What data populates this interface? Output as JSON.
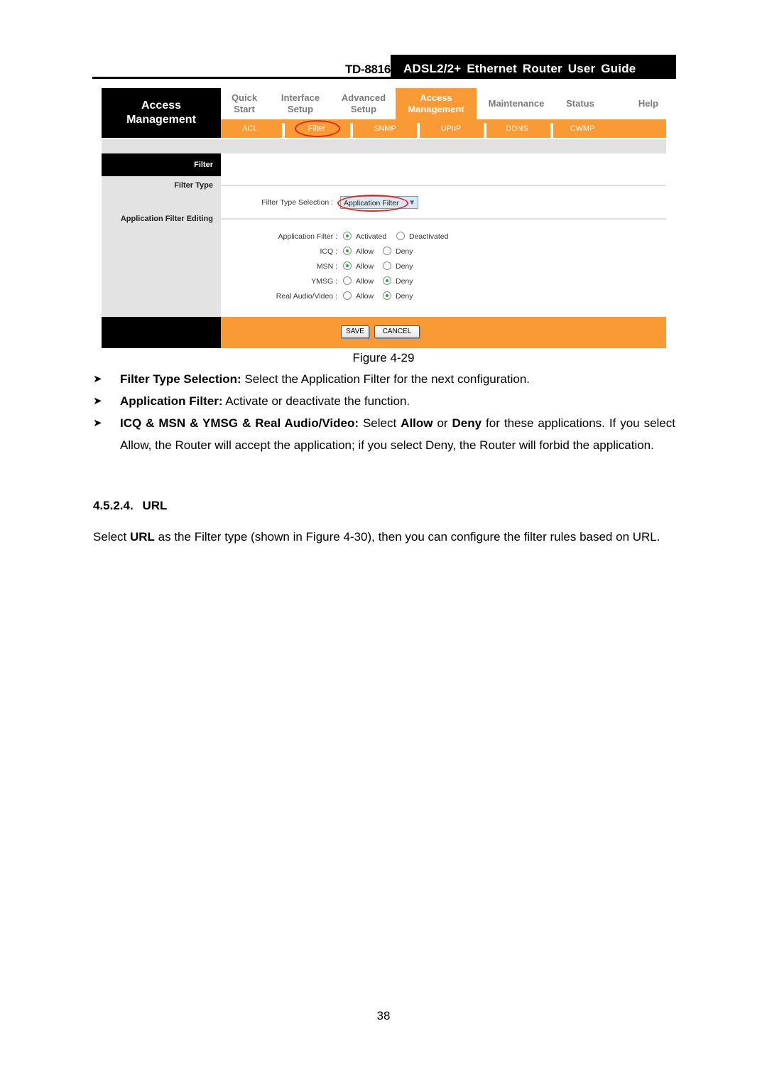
{
  "running_header": {
    "model": "TD-8816",
    "title": "ADSL2/2+ Ethernet Router User Guide"
  },
  "figure": {
    "brand": "Access Management",
    "top_nav": [
      {
        "label": "Quick Start",
        "active": false
      },
      {
        "label": "Interface Setup",
        "active": false
      },
      {
        "label": "Advanced Setup",
        "active": false
      },
      {
        "label": "Access Management",
        "active": true
      },
      {
        "label": "Maintenance",
        "active": false
      },
      {
        "label": "Status",
        "active": false
      },
      {
        "label": "Help",
        "active": false
      }
    ],
    "sub_nav": [
      {
        "label": "ACL",
        "highlighted": false
      },
      {
        "label": "Filter",
        "highlighted": true
      },
      {
        "label": "SNMP",
        "highlighted": false
      },
      {
        "label": "UPnP",
        "highlighted": false
      },
      {
        "label": "DDNS",
        "highlighted": false
      },
      {
        "label": "CWMP",
        "highlighted": false
      }
    ],
    "section_header": "Filter",
    "left_labels": {
      "filter_type": "Filter Type",
      "app_filter_editing": "Application Filter Editing"
    },
    "filter_type_selection": {
      "label": "Filter Type Selection :",
      "value": "Application Filter"
    },
    "radio_rows": [
      {
        "label": "Application Filter :",
        "options": [
          "Activated",
          "Deactivated"
        ],
        "selected": "Activated"
      },
      {
        "label": "ICQ :",
        "options": [
          "Allow",
          "Deny"
        ],
        "selected": "Allow"
      },
      {
        "label": "MSN :",
        "options": [
          "Allow",
          "Deny"
        ],
        "selected": "Allow"
      },
      {
        "label": "YMSG :",
        "options": [
          "Allow",
          "Deny"
        ],
        "selected": "Deny"
      },
      {
        "label": "Real Audio/Video :",
        "options": [
          "Allow",
          "Deny"
        ],
        "selected": "Deny"
      }
    ],
    "buttons": {
      "save": "SAVE",
      "cancel": "CANCEL"
    },
    "colors": {
      "accent_orange": "#f99a35",
      "highlight_red": "#e02a20"
    }
  },
  "caption": "Figure 4-29",
  "bullets": [
    {
      "bold": "Filter Type Selection:",
      "text": " Select the Application Filter for the next configuration."
    },
    {
      "bold": "Application Filter:",
      "text": " Activate or deactivate the function."
    },
    {
      "bold": "ICQ & MSN & YMSG & Real Audio/Video:",
      "text_1": " Select ",
      "bold_2": "Allow",
      "text_2": " or ",
      "bold_3": "Deny",
      "text_3": " for these applications. If you select Allow, the Router will accept the application; if you select Deny, the Router will forbid the application."
    }
  ],
  "section": {
    "number": "4.5.2.4.",
    "title": "URL"
  },
  "paragraph": {
    "text_1": "Select ",
    "bold": "URL",
    "text_2": " as the Filter type (shown in Figure 4-30), then you can configure the filter rules based on URL."
  },
  "page_number": "38"
}
